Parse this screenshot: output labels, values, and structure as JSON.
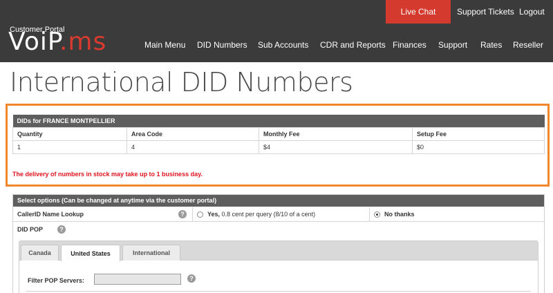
{
  "header": {
    "logo_subtitle": "Customer Portal",
    "logo_text_a": "VoiP",
    "logo_text_b": ".ms",
    "live_chat": "Live Chat",
    "support_tickets": "Support Tickets",
    "logout": "Logout",
    "nav": [
      "Main Menu",
      "DID Numbers",
      "Sub Accounts",
      "CDR and Reports",
      "Finances",
      "Support",
      "Rates",
      "Reseller"
    ]
  },
  "page_title": "International DID Numbers",
  "did_table": {
    "caption": "DIDs for FRANCE MONTPELLIER",
    "columns": [
      "Quantity",
      "Area Code",
      "Monthly Fee",
      "Setup Fee"
    ],
    "row": [
      "1",
      "4",
      "$4",
      "$0"
    ]
  },
  "warning": "The delivery of numbers in stock may take up to 1 business day.",
  "options": {
    "heading": "Select options (Can be changed at anytime via the customer portal)",
    "callerid_label": "CallerID Name Lookup",
    "yes_option_bold": "Yes,",
    "yes_option_rest": " 0.8 cent per query (8/10 of a cent)",
    "no_option": "No thanks",
    "selected": "No thanks",
    "did_pop_label": "DID POP",
    "tabs": [
      "Canada",
      "United States",
      "International"
    ],
    "active_tab": "United States",
    "filter_label": "Filter POP Servers:",
    "filter_value": ""
  },
  "colors": {
    "header_bg": "#3b3b3b",
    "brand_red": "#d43a2e",
    "highlight": "#f0882b",
    "warning": "#e0131d"
  }
}
